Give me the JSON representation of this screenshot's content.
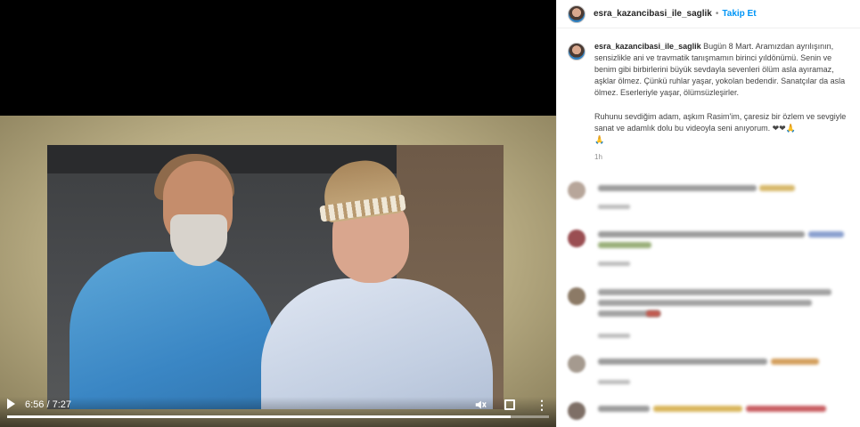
{
  "video": {
    "current_time": "6:56",
    "duration": "7:27",
    "time_display": "6:56 / 7:27",
    "progress_fraction": 0.93
  },
  "post": {
    "username": "esra_kazancibasi_ile_saglik",
    "follow_label": "Takip Et",
    "separator": "•",
    "caption_text": "Bugün 8 Mart. Aramızdan ayrılışının, sensizlikle ani ve travmatik tanışmamın birinci yıldönümü. Senin ve benim gibi birbirlerini büyük sevdayla sevenleri ölüm asla ayıramaz, aşklar ölmez. Çünkü ruhlar yaşar, yokolan bedendir. Sanatçılar da asla ölmez. Eserleriyle yaşar, ölümsüzleşirler.",
    "caption_text2": "Ruhunu sevdiğim adam, aşkım Rasim'im, çaresiz bir özlem ve sevgiyle sanat ve adamlık dolu bu videoyla seni anıyorum. ❤❤🙏",
    "caption_emoji": "🙏",
    "caption_time": "1h"
  },
  "colors": {
    "follow": "#0095f6",
    "username": "#262626",
    "muted": "#8e8e8e"
  },
  "icons": [
    "play-icon",
    "mute-icon",
    "fullscreen-icon",
    "more-icon"
  ]
}
